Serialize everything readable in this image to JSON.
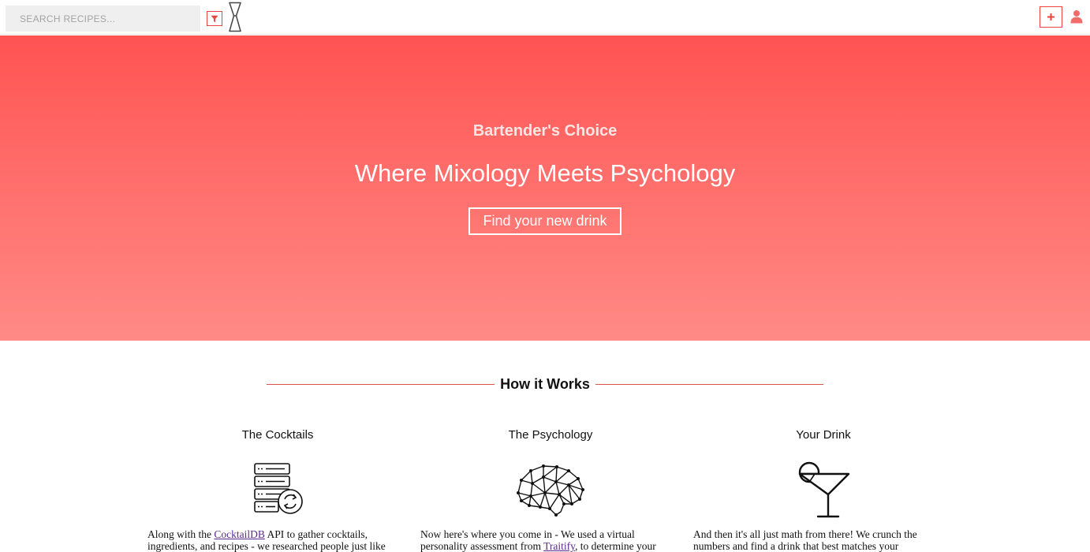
{
  "search": {
    "placeholder": "SEARCH RECIPES..."
  },
  "header": {
    "filter_icon": "filter-icon",
    "logo_icon": "jigger-icon",
    "add_icon": "plus-icon",
    "user_icon": "user-icon"
  },
  "hero": {
    "subtitle": "Bartender's Choice",
    "title": "Where Mixology Meets Psychology",
    "cta_label": "Find your new drink"
  },
  "how_it_works": {
    "title": "How it Works",
    "columns": [
      {
        "heading": "The Cocktails",
        "icon": "database-sync-icon",
        "text_before": "Along with the ",
        "link": "CocktailDB",
        "text_after": " API to gather cocktails, ingredients, and recipes - we researched people just like"
      },
      {
        "heading": "The Psychology",
        "icon": "brain-network-icon",
        "text_before": "Now here's where you come in - We used a virtual personality assessment from ",
        "link": "Traitify",
        "text_after": ", to determine your"
      },
      {
        "heading": "Your Drink",
        "icon": "cocktail-glass-icon",
        "text_before": "And then it's all just math from there! We crunch the numbers and find a drink that best matches your",
        "link": "",
        "text_after": ""
      }
    ]
  },
  "colors": {
    "accent": "#e8453c",
    "hero_top": "#ff5352",
    "hero_bottom": "#ff8a86",
    "link": "#5b2a8c"
  }
}
